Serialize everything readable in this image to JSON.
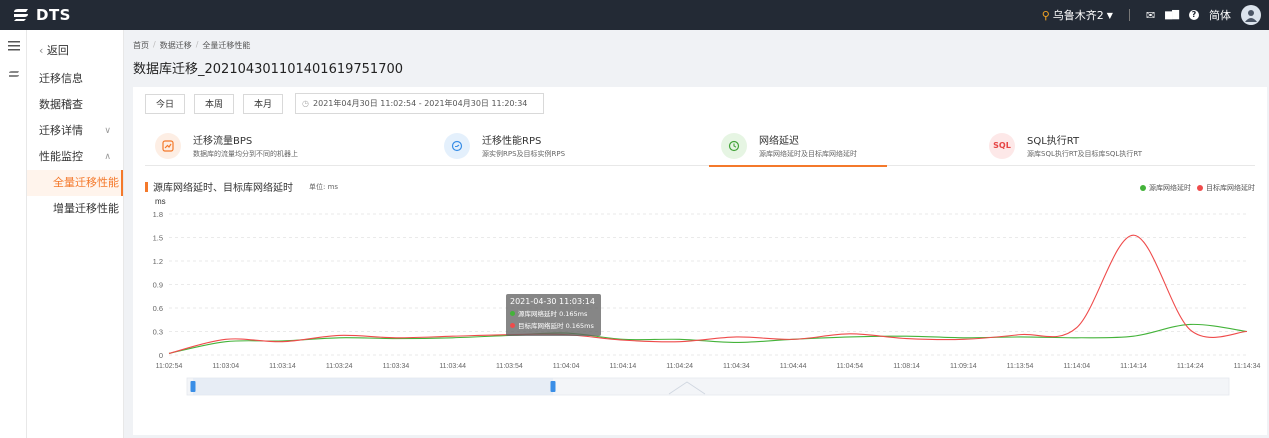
{
  "app": {
    "name": "DTS"
  },
  "topbar": {
    "region": "乌鲁木齐2",
    "lang": "简体",
    "icons": [
      "location-icon",
      "mail-icon",
      "chart-icon",
      "help-icon",
      "avatar"
    ]
  },
  "sidebar": {
    "back": "返回",
    "items": [
      {
        "label": "迁移信息"
      },
      {
        "label": "数据稽查"
      },
      {
        "label": "迁移详情",
        "chevron": "∨"
      },
      {
        "label": "性能监控",
        "chevron": "∧"
      },
      {
        "label": "全量迁移性能"
      },
      {
        "label": "增量迁移性能"
      }
    ]
  },
  "breadcrumb": [
    "首页",
    "数据迁移",
    "全量迁移性能"
  ],
  "page_title": "数据库迁移_20210430110140161975170​0",
  "date_filter": {
    "buttons": [
      "今日",
      "本周",
      "本月"
    ],
    "range": "2021年04月30日 11:02:54  -  2021年04月30日 11:20:34"
  },
  "tabs": [
    {
      "title": "迁移流量BPS",
      "desc": "数据库的流量均分到不同的机器上",
      "color": "#f4792b",
      "bg": "#fdeee4"
    },
    {
      "title": "迁移性能RPS",
      "desc": "源实例RPS及目标实例RPS",
      "color": "#3a8ee6",
      "bg": "#e4f0fc"
    },
    {
      "title": "网络延迟",
      "desc": "源库网络延时及目标库网络延时",
      "color": "#44a33a",
      "bg": "#e6f5e3"
    },
    {
      "title": "SQL执行RT",
      "desc": "源库SQL执行RT及目标库SQL执行RT",
      "icon_text": "SQL",
      "color": "#e64545",
      "bg": "#fde8e8"
    }
  ],
  "chart_header": {
    "title": "源库网络延时、目标库网络延时",
    "unit": "单位: ms"
  },
  "legend": [
    {
      "name": "源库网络延时",
      "color": "#44b33a"
    },
    {
      "name": "目标库网络延时",
      "color": "#ef4b4b"
    }
  ],
  "tooltip": {
    "time": "2021-04-30 11:03:14",
    "rows": [
      {
        "label": "源库网络延时 0.165ms",
        "color": "#44b33a"
      },
      {
        "label": "目标库网络延时 0.165ms",
        "color": "#ef4b4b"
      }
    ]
  },
  "chart_data": {
    "type": "line",
    "ylabel": "ms",
    "ylim": [
      0,
      1.8
    ],
    "yticks": [
      0,
      0.3,
      0.6,
      0.9,
      1.2,
      1.5,
      1.8
    ],
    "x": [
      "11:02:54",
      "11:03:04",
      "11:03:14",
      "11:03:24",
      "11:03:34",
      "11:03:44",
      "11:03:54",
      "11:04:04",
      "11:04:14",
      "11:04:24",
      "11:04:34",
      "11:04:44",
      "11:04:54",
      "11:08:14",
      "11:09:14",
      "11:13:54",
      "11:14:04",
      "11:14:14",
      "11:14:24",
      "11:14:34"
    ],
    "series": [
      {
        "name": "源库网络延时",
        "color": "#44b33a",
        "values": [
          0.02,
          0.17,
          0.18,
          0.22,
          0.21,
          0.22,
          0.25,
          0.28,
          0.2,
          0.2,
          0.16,
          0.2,
          0.23,
          0.24,
          0.22,
          0.23,
          0.22,
          0.24,
          0.39,
          0.3
        ]
      },
      {
        "name": "目标库网络延时",
        "color": "#ef4b4b",
        "values": [
          0.02,
          0.2,
          0.17,
          0.25,
          0.22,
          0.24,
          0.26,
          0.26,
          0.19,
          0.17,
          0.23,
          0.2,
          0.27,
          0.21,
          0.2,
          0.26,
          0.35,
          1.53,
          0.32,
          0.3
        ]
      }
    ]
  }
}
